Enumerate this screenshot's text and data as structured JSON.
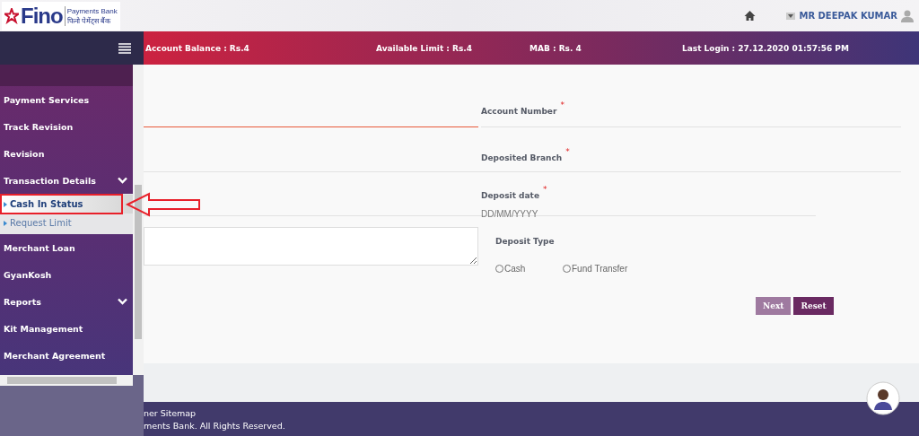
{
  "header": {
    "logo": {
      "wordmark": "Fino",
      "line_1": "Payments Bank",
      "line_2": "फिनो पेमेंट्स बैंक"
    },
    "user": "MR DEEPAK KUMAR"
  },
  "info_bar": [
    {
      "text": "Account Balance : Rs.4"
    },
    {
      "text": "Available Limit : Rs.4"
    },
    {
      "text": "MAB : Rs. 4"
    },
    {
      "text": "**Last Login :** 27.12.2020 01:57:56 PM"
    }
  ],
  "sidebar": {
    "items": [
      {
        "label": "Payment Services",
        "kind": "link"
      },
      {
        "label": "Track Revision",
        "kind": "link"
      },
      {
        "label": "Revision",
        "kind": "link"
      },
      {
        "label": "Transaction Details",
        "kind": "group",
        "expanded": true,
        "children": [
          {
            "label": "Cash In Status",
            "selected": true
          },
          {
            "label": "Request Limit",
            "selected": false
          }
        ]
      },
      {
        "label": "Merchant Loan",
        "kind": "link"
      },
      {
        "label": "GyanKosh",
        "kind": "link"
      },
      {
        "label": "Reports",
        "kind": "group"
      },
      {
        "label": "Kit Management",
        "kind": "link"
      },
      {
        "label": "Merchant Agreement",
        "kind": "link"
      }
    ]
  },
  "form": {
    "required_marker": "*",
    "account_number": {
      "label": "Account Number",
      "required": true
    },
    "deposited_branch": {
      "label": "Deposited Branch",
      "required": true
    },
    "deposit_date": {
      "label": "Deposit date",
      "required": true,
      "placeholder": "DD/MM/YYYY"
    },
    "deposit_type": {
      "label": "Deposit Type",
      "options": [
        {
          "label": "Cash",
          "checked": false
        },
        {
          "label": "Fund Transfer",
          "checked": false
        }
      ]
    },
    "buttons": [
      {
        "label": "Next",
        "disabled": true
      },
      {
        "label": "Reset",
        "disabled": false
      }
    ]
  },
  "footer": {
    "line_1": "ner Sitemap",
    "line_2": "ments Bank. All Rights Reserved."
  }
}
